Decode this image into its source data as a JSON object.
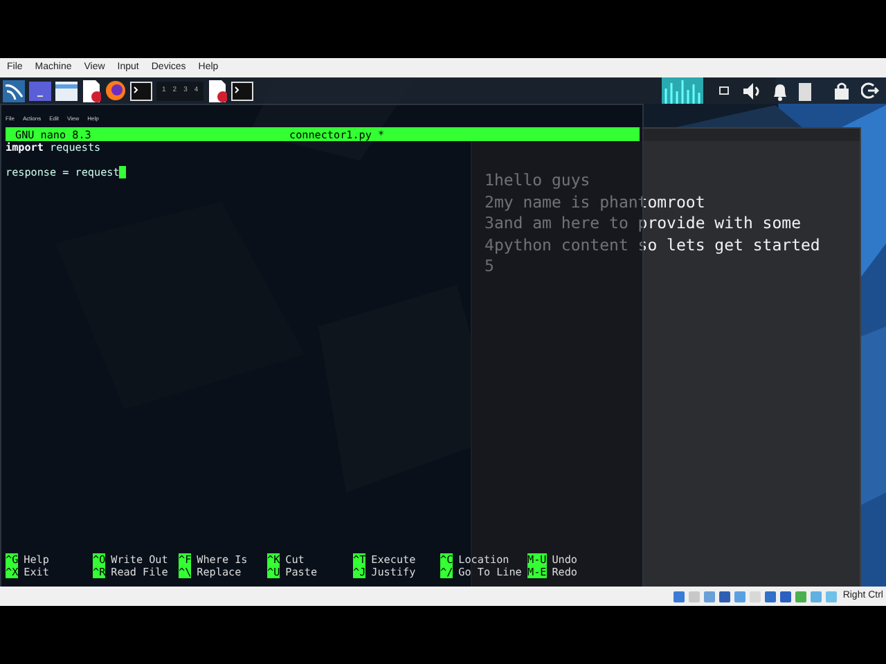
{
  "host_menu": [
    "File",
    "Machine",
    "View",
    "Input",
    "Devices",
    "Help"
  ],
  "panel": {
    "workspaces": [
      "1",
      "2",
      "3",
      "4"
    ]
  },
  "mousepad": {
    "lines": [
      {
        "number": "1",
        "text": "hello guys"
      },
      {
        "number": "2",
        "text": "my name is phantomroot"
      },
      {
        "number": "3",
        "text": "and am here to provide with some"
      },
      {
        "number": "4",
        "text": "python content so lets get started"
      },
      {
        "number": "5"
      }
    ]
  },
  "terminal": {
    "menu": [
      "File",
      "Actions",
      "Edit",
      "View",
      "Help"
    ],
    "nano": {
      "version": "GNU nano 8.3",
      "filename": "connector1.py *",
      "lines": [
        {
          "text": "**import** requests",
          "cursor": false
        },
        {
          "cursor": false
        },
        {
          "text": "response = request",
          "cursor": true
        }
      ],
      "shortcuts": [
        [
          {
            "key": "^G",
            "label": "Help"
          },
          {
            "key": "^O",
            "label": "Write Out"
          },
          {
            "key": "^F",
            "label": "Where Is"
          },
          {
            "key": "^K",
            "label": "Cut"
          },
          {
            "key": "^T",
            "label": "Execute"
          },
          {
            "key": "^C",
            "label": "Location"
          },
          {
            "key": "M-U",
            "label": "Undo"
          }
        ],
        [
          {
            "key": "^X",
            "label": "Exit"
          },
          {
            "key": "^R",
            "label": "Read File"
          },
          {
            "key": "^\\",
            "label": "Replace"
          },
          {
            "key": "^U",
            "label": "Paste"
          },
          {
            "key": "^J",
            "label": "Justify"
          },
          {
            "key": "^/",
            "label": "Go To Line"
          },
          {
            "key": "M-E",
            "label": "Redo"
          }
        ]
      ]
    }
  },
  "status_bar": {
    "host_key": "Right Ctrl"
  }
}
